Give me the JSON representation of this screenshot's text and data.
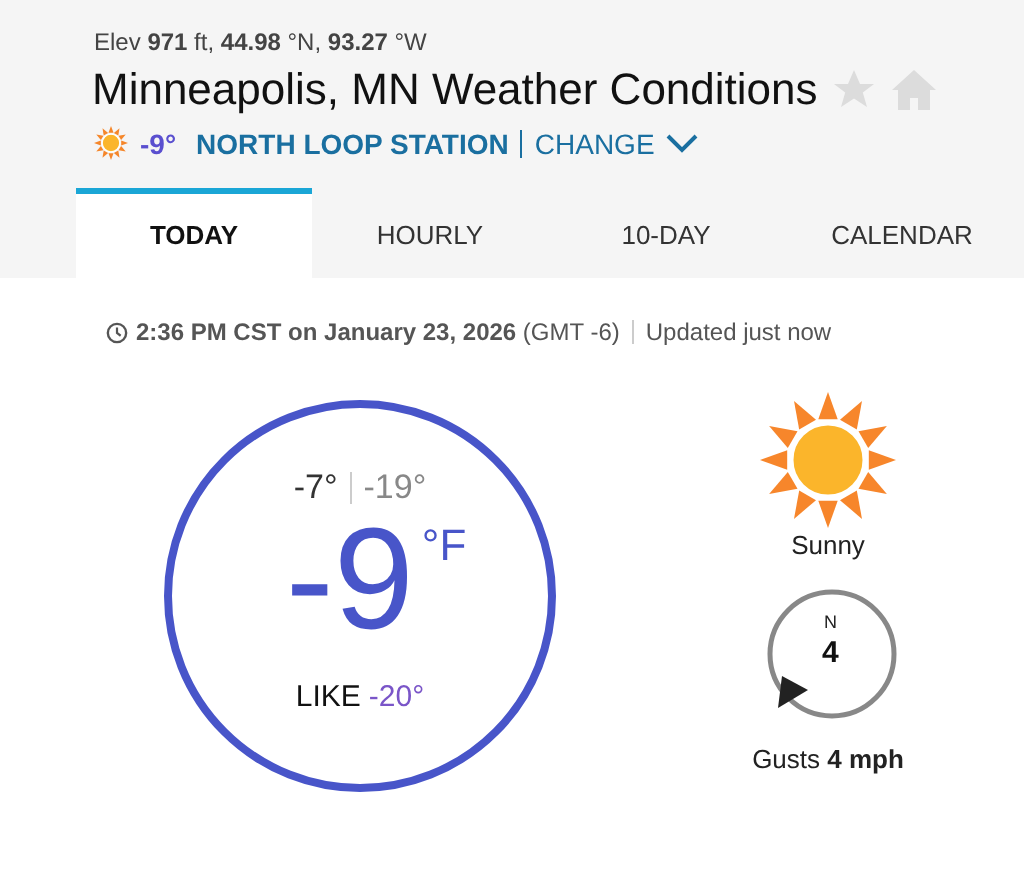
{
  "header": {
    "elevation": "Elev **971** ft, **44.98** °N, **93.27** °W",
    "title": "Minneapolis, MN Weather Conditions",
    "station_temp": "-9°",
    "station": "NORTH LOOP STATION",
    "change": "CHANGE"
  },
  "tabs": [
    {
      "label": "TODAY",
      "selected": true
    },
    {
      "label": "HOURLY",
      "selected": false
    },
    {
      "label": "10-DAY",
      "selected": false
    },
    {
      "label": "CALENDAR",
      "selected": false
    }
  ],
  "timestamp": {
    "time": "**2:36 PM CST on January 23, 2026** (GMT -6)",
    "updated": "Updated just now"
  },
  "current": {
    "high": "-7°",
    "low": "-19°",
    "temp": "-9",
    "unit": "°F",
    "like_label": "LIKE",
    "like_value": "-20°"
  },
  "condition": {
    "label": "Sunny"
  },
  "wind": {
    "direction": "N",
    "speed": "4",
    "gusts": "Gusts **4 mph**"
  }
}
